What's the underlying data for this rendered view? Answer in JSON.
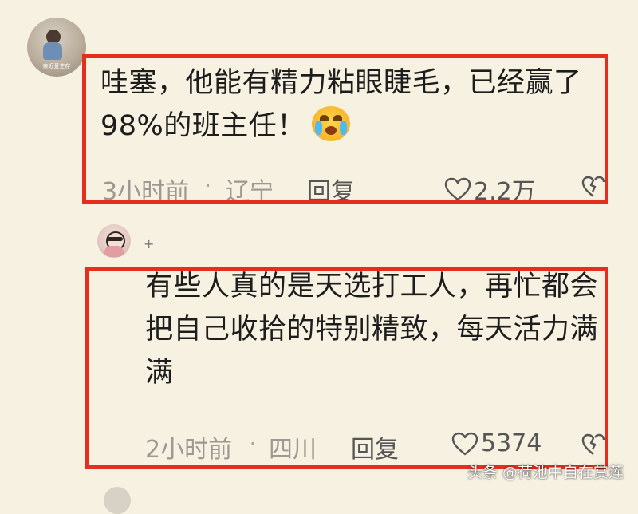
{
  "comments": [
    {
      "text": "哇塞，他能有精力粘眼睫毛，已经赢了98%的班主任！",
      "emoji": "crying-laughing-emoji",
      "time": "3小时前",
      "separator": "·",
      "location": "辽宁",
      "reply_label": "回复",
      "like_count": "2.2万",
      "avatar_caption": "亲近爱生存"
    },
    {
      "reply_user": "+",
      "text": "有些人真的是天选打工人，再忙都会把自己收拾的特别精致，每天活力满满",
      "time": "2小时前",
      "separator": "·",
      "location": "四川",
      "reply_label": "回复",
      "like_count": "5374"
    }
  ],
  "watermark": "头条 @荷池中自在赏莲",
  "colors": {
    "background": "#f7f1e1",
    "highlight": "#e62e1e",
    "meta_text": "#9d9891"
  }
}
